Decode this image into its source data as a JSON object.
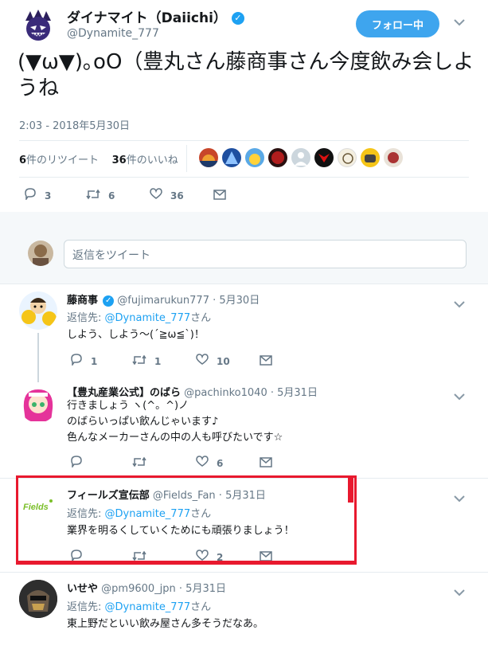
{
  "tweet": {
    "author_name": "ダイナマイト（Daiichi）",
    "author_handle": "@Dynamite_777",
    "follow_label": "フォロー中",
    "text": "(▼ω▼)｡oO（豊丸さん藤商事さん今度飲み会しようね",
    "time": "2:03 - 2018年5月30日",
    "retweets_count": "6",
    "retweets_label": "件のリツイート",
    "likes_count": "36",
    "likes_label": "件のいいね",
    "actions": {
      "reply": "3",
      "retweet": "6",
      "like": "36"
    }
  },
  "reply_box": {
    "placeholder": "返信をツイート"
  },
  "replies": [
    {
      "name": "藤商事",
      "handle": "@fujimarukun777",
      "date": "5月30日",
      "reply_to_prefix": "返信先:",
      "reply_to_user": "@Dynamite_777",
      "reply_to_suffix": "さん",
      "text_lines": [
        "しよう、しよう〜(´≧ω≦`)！"
      ],
      "actions": {
        "reply": "1",
        "retweet": "1",
        "like": "10"
      }
    },
    {
      "name": "【豊丸産業公式】のばら",
      "handle": "@pachinko1040",
      "date": "5月31日",
      "text_lines": [
        "行きましょう ヽ(^。^)ノ",
        "のばらいっぱい飲んじゃいます♪",
        "色んなメーカーさんの中の人も呼びたいです☆"
      ],
      "actions": {
        "reply": "",
        "retweet": "",
        "like": "6"
      }
    },
    {
      "name": "フィールズ宣伝部",
      "handle": "@Fields_Fan",
      "date": "5月31日",
      "reply_to_prefix": "返信先:",
      "reply_to_user": "@Dynamite_777",
      "reply_to_suffix": "さん",
      "text_lines": [
        "業界を明るくしていくためにも頑張りましょう！"
      ],
      "avatar_logo": "Fields",
      "actions": {
        "reply": "",
        "retweet": "",
        "like": "2"
      }
    },
    {
      "name": "いせや",
      "handle": "@pm9600_jpn",
      "date": "5月31日",
      "reply_to_prefix": "返信先:",
      "reply_to_user": "@Dynamite_777",
      "reply_to_suffix": "さん",
      "text_lines": [
        "東上野だといい飲み屋さん多そうだなあ。"
      ]
    }
  ],
  "colors": {
    "accent": "#1da1f2",
    "follow_bg": "#3ea5ee",
    "highlight": "#e8192e",
    "muted": "#657786"
  },
  "icons": [
    "reply-icon",
    "retweet-icon",
    "like-icon",
    "dm-icon",
    "verified-icon",
    "chevron-down-icon"
  ]
}
